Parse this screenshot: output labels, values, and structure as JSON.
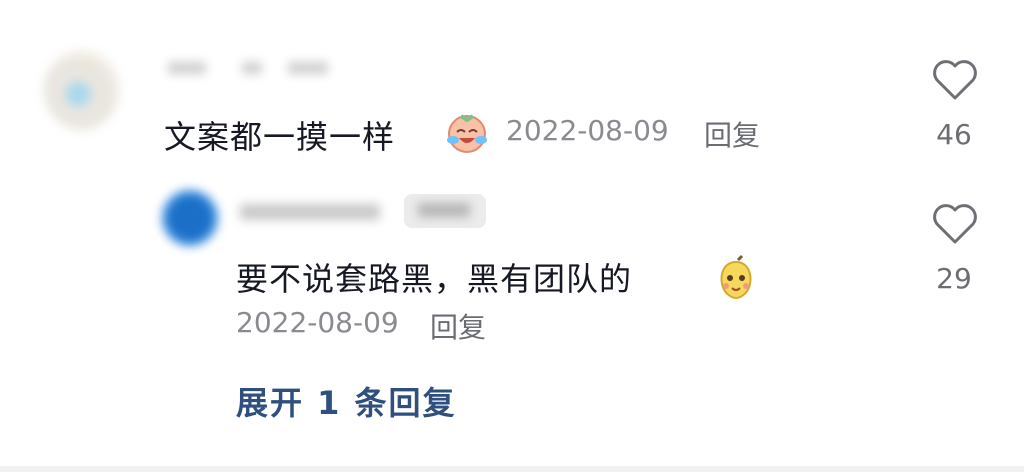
{
  "comments": [
    {
      "text": "文案都一摸一样",
      "date": "2022-08-09",
      "reply_label": "回复",
      "likes": "46",
      "emoji_icon": "crying-laughing-face-icon"
    }
  ],
  "replies": [
    {
      "text": "要不说套路黑，黑有团队的",
      "date": "2022-08-09",
      "reply_label": "回复",
      "likes": "29",
      "emoji_icon": "pear-face-icon"
    }
  ],
  "expand_label": "展开 1 条回复",
  "colors": {
    "text": "#161823",
    "meta": "#8a8b91",
    "link": "#2f4f7f"
  }
}
